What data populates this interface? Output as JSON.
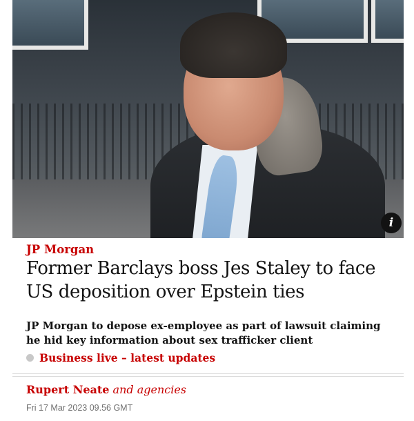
{
  "hero": {
    "info_icon": "info-icon",
    "info_label": "i"
  },
  "article": {
    "kicker": "JP Morgan",
    "headline": "Former Barclays boss Jes Staley to face US deposition over Epstein ties",
    "standfirst": "JP Morgan to depose ex-employee as part of lawsuit claiming he hid key information about sex trafficker client",
    "live_link": "Business live – latest updates",
    "author": "Rupert Neate",
    "agencies": "and agencies",
    "date": "Fri 17 Mar 2023 09.56 GMT"
  },
  "colors": {
    "accent": "#c70000",
    "text": "#121212",
    "muted": "#707070"
  }
}
